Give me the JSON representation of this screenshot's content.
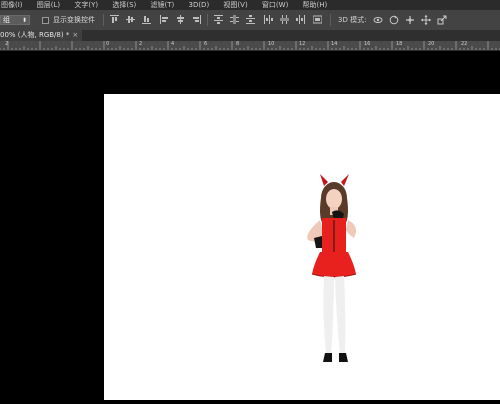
{
  "menu": {
    "items": [
      "图像(I)",
      "图层(L)",
      "文字(Y)",
      "选择(S)",
      "滤镜(T)",
      "3D(D)",
      "视图(V)",
      "窗口(W)",
      "帮助(H)"
    ]
  },
  "options_bar": {
    "auto_select_value": "组",
    "show_transform_label": "显示变换控件",
    "mode_3d_label": "3D 模式:"
  },
  "tab": {
    "title": "00% (人物, RGB/8) *",
    "close": "×"
  },
  "ruler": {
    "labels": [
      "2",
      "0",
      "2",
      "4",
      "6",
      "8",
      "10",
      "12",
      "14",
      "16",
      "18",
      "20",
      "22"
    ]
  },
  "colors": {
    "menubar": "#2b2b2b",
    "optionsbar": "#434343",
    "canvas_bg": "#000000",
    "document_bg": "#ffffff",
    "costume_red": "#e8201e"
  }
}
